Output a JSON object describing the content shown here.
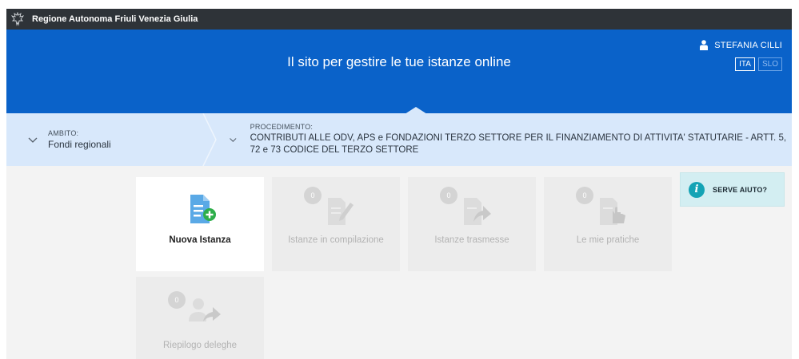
{
  "topbar": {
    "brand": "Regione Autonoma Friuli Venezia Giulia"
  },
  "header": {
    "title": "Il sito per gestire le tue istanze online",
    "user_name": "STEFANIA CILLI",
    "languages": [
      "ITA",
      "SLO"
    ],
    "active_language": "ITA"
  },
  "selector": {
    "ambito_label": "AMBITO:",
    "ambito_value": "Fondi regionali",
    "procedimento_label": "PROCEDIMENTO:",
    "procedimento_value": "CONTRIBUTI ALLE ODV, APS e FONDAZIONI TERZO SETTORE PER IL FINANZIAMENTO DI ATTIVITA' STATUTARIE - ARTT. 5, 72 e 73 CODICE DEL TERZO SETTORE"
  },
  "tiles": [
    {
      "label": "Nuova Istanza",
      "icon": "new-document-plus-icon"
    },
    {
      "label": "Istanze in compilazione",
      "count": "0",
      "icon": "document-pencil-icon"
    },
    {
      "label": "Istanze trasmesse",
      "count": "0",
      "icon": "document-arrow-icon"
    },
    {
      "label": "Le mie pratiche",
      "count": "0",
      "icon": "document-hand-icon"
    },
    {
      "label": "Riepilogo deleghe",
      "count": "0",
      "icon": "person-arrow-icon"
    }
  ],
  "help": {
    "label": "SERVE AIUTO?",
    "icon_glyph": "i"
  },
  "colors": {
    "topbar": "#2e3338",
    "header": "#0a62c9",
    "selector": "#d8e8fb",
    "help_bg": "#d3eef2",
    "accent_green": "#2dae4a",
    "doc_blue": "#5aa9e6"
  }
}
